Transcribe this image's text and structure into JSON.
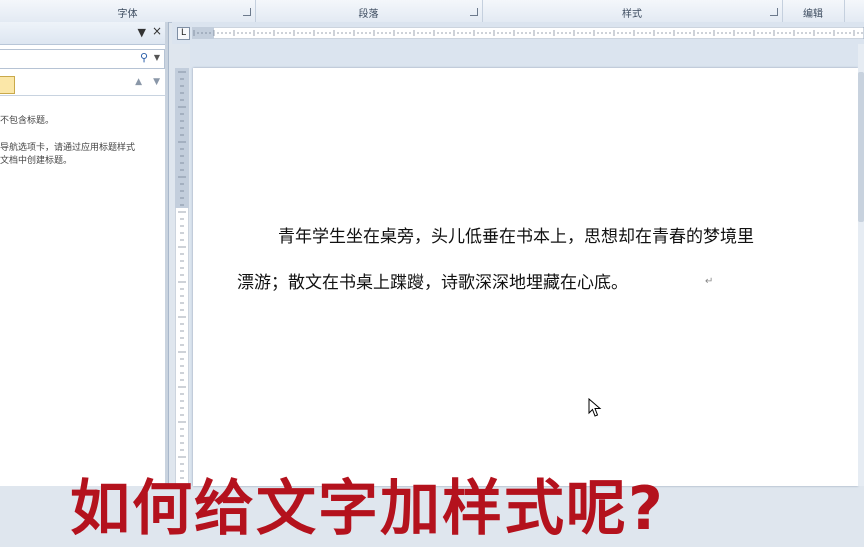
{
  "ribbon": {
    "groups": [
      {
        "label": "字体"
      },
      {
        "label": "段落"
      },
      {
        "label": "样式"
      },
      {
        "label": "编辑"
      }
    ]
  },
  "nav_pane": {
    "search_placeholder": "",
    "message_line1": "不包含标题。",
    "message_line2": "导航选项卡，请通过应用标题样式",
    "message_line3": "文档中创建标题。"
  },
  "ruler": {
    "labels": [
      "L",
      "8",
      "6",
      "4",
      "2",
      "2",
      "4",
      "6",
      "8",
      "10",
      "12",
      "14",
      "16",
      "18",
      "20",
      "22",
      "24",
      "26",
      "28",
      "30",
      "32",
      "34",
      "36",
      "38",
      "40",
      "42",
      "44",
      "46",
      "48",
      "50",
      "52",
      "54",
      "56",
      "58",
      "60",
      "62",
      "64",
      "66",
      "68",
      "70",
      "72",
      "74",
      "76",
      "78",
      "80",
      "82"
    ]
  },
  "document": {
    "line1": "青年学生坐在桌旁，头儿低垂在书本上，思想却在青春的梦境里",
    "line2": "漂游；散文在书桌上蹀躞，诗歌深深地埋藏在心底。",
    "paragraph_mark": "↵"
  },
  "overlay": {
    "caption": "如何给文字加样式呢?"
  },
  "colors": {
    "overlay_text": "#b4121d",
    "ribbon_bg": "#e3eaf3"
  }
}
